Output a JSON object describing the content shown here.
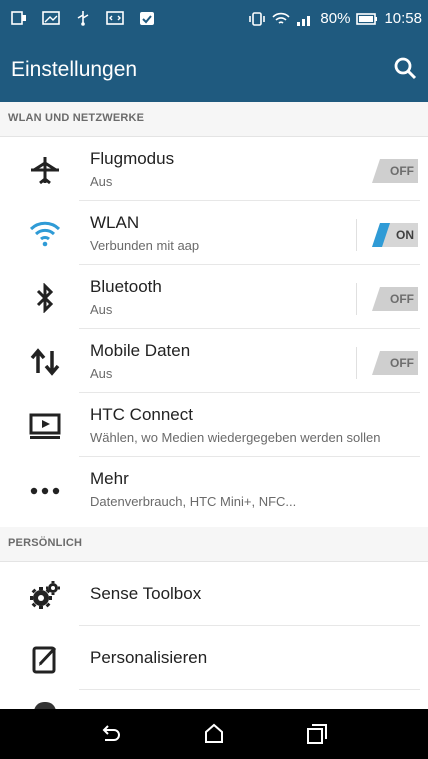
{
  "status_bar": {
    "battery_text": "80%",
    "time": "10:58",
    "icons": [
      "screen-icon",
      "image-icon",
      "usb-icon",
      "code-icon",
      "clipboard-icon",
      "vibrate-icon",
      "wifi-icon",
      "signal-icon",
      "battery-icon"
    ]
  },
  "app_bar": {
    "title": "Einstellungen",
    "search_icon": "search-icon"
  },
  "sections": {
    "wireless": "WLAN UND NETZWERKE",
    "personal": "PERSÖNLICH"
  },
  "settings": {
    "airplane": {
      "title": "Flugmodus",
      "subtitle": "Aus",
      "toggle": "OFF"
    },
    "wlan": {
      "title": "WLAN",
      "subtitle": "Verbunden mit aap",
      "toggle": "ON"
    },
    "bluetooth": {
      "title": "Bluetooth",
      "subtitle": "Aus",
      "toggle": "OFF"
    },
    "mobile": {
      "title": "Mobile Daten",
      "subtitle": "Aus",
      "toggle": "OFF"
    },
    "htc_connect": {
      "title": "HTC Connect",
      "subtitle": "Wählen, wo Medien wiedergegeben werden sollen"
    },
    "more": {
      "title": "Mehr",
      "subtitle": "Datenverbrauch, HTC Mini+, NFC..."
    },
    "sense_toolbox": {
      "title": "Sense Toolbox"
    },
    "personalize": {
      "title": "Personalisieren"
    }
  },
  "colors": {
    "header": "#1f5a7f",
    "accent": "#2f9bd6",
    "toggle_off": "#d0d0d0",
    "toggle_on": "#2f9bd6"
  }
}
